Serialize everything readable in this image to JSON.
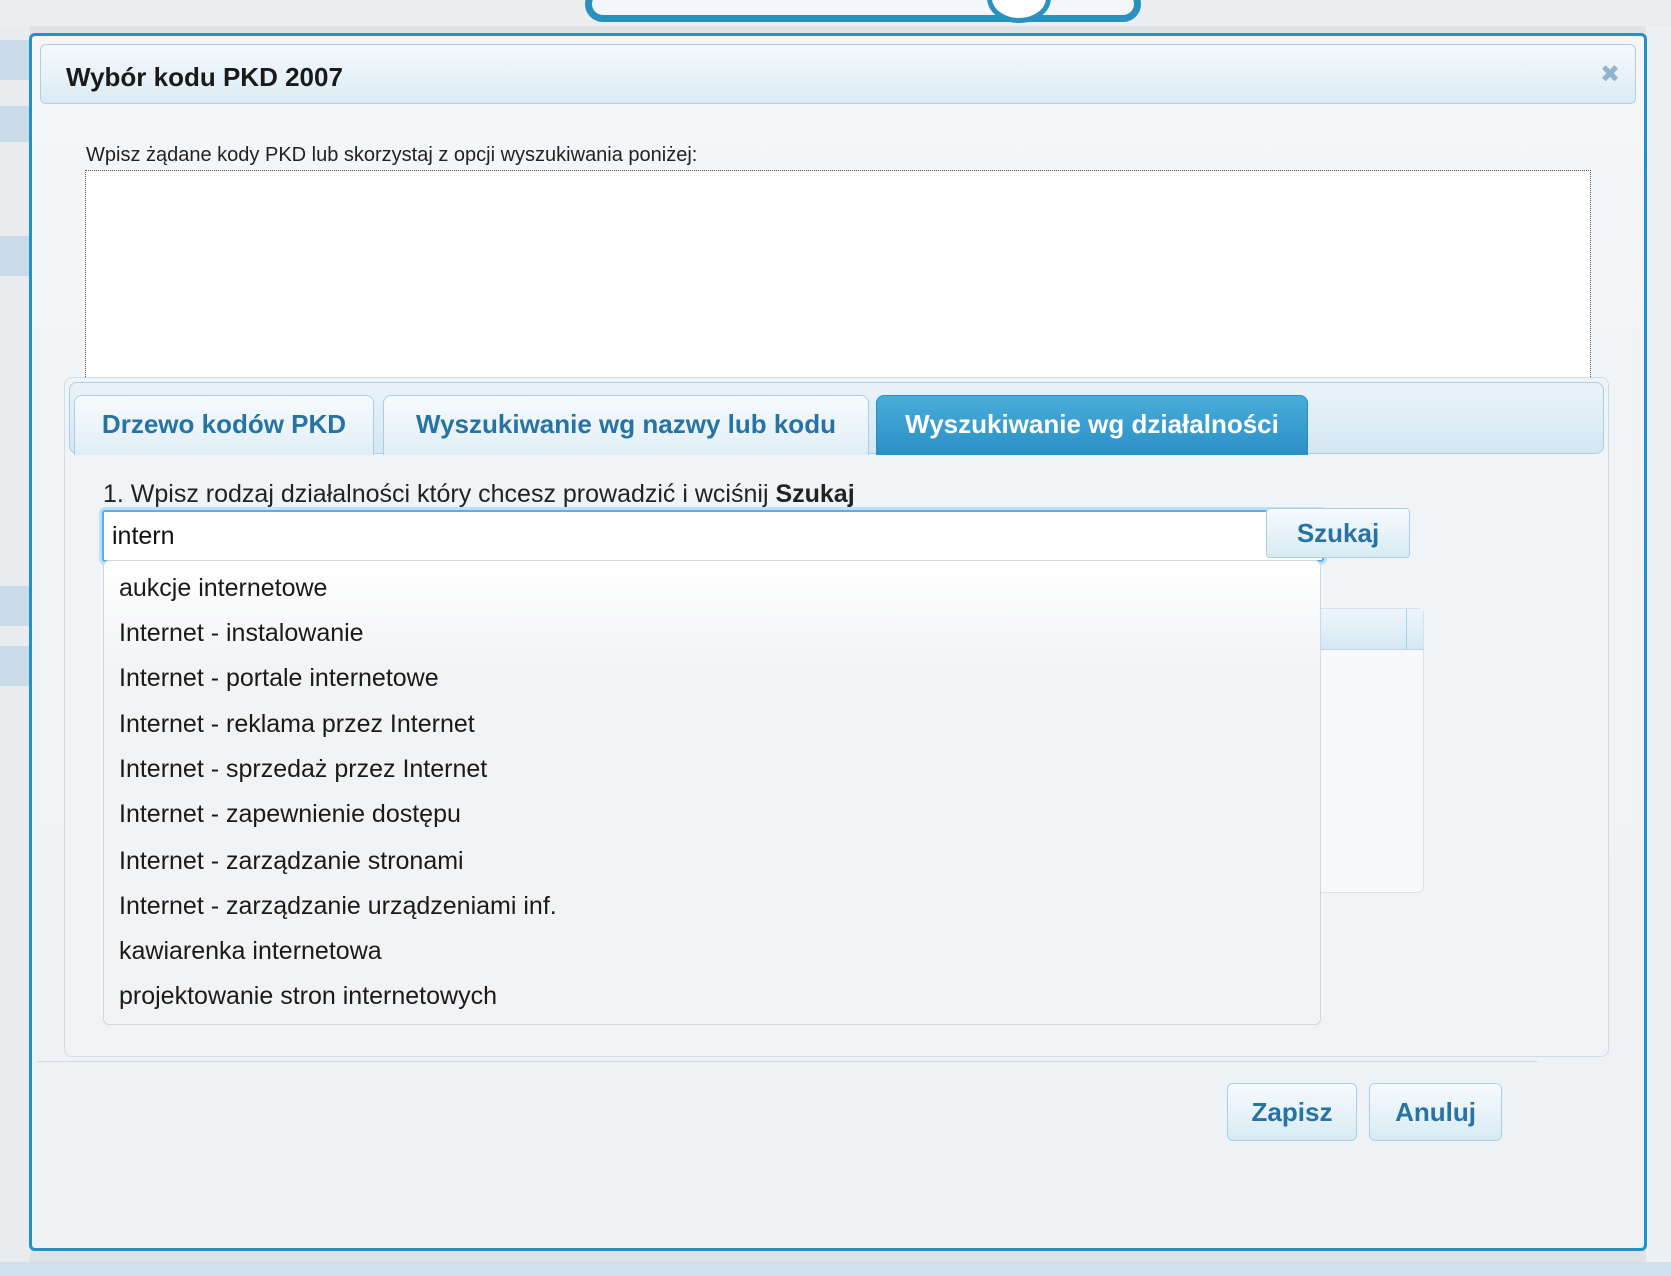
{
  "dialog": {
    "title": "Wybór kodu PKD 2007",
    "close_symbol": "✖",
    "instructions": "Wpisz żądane kody PKD lub skorzystaj z opcji wyszukiwania poniżej:",
    "codes_value": ""
  },
  "tabs": [
    {
      "label": "Drzewo kodów PKD",
      "active": false
    },
    {
      "label": "Wyszukiwanie wg nazwy lub kodu",
      "active": false
    },
    {
      "label": "Wyszukiwanie wg działalności",
      "active": true
    }
  ],
  "search": {
    "step_label": "1. Wpisz rodzaj działalności który chcesz prowadzić i wciśnij ",
    "step_label_bold": "Szukaj",
    "value": "intern",
    "button_label": "Szukaj"
  },
  "autocomplete": [
    "aukcje internetowe",
    "Internet - instalowanie",
    "Internet - portale internetowe",
    "Internet - reklama przez Internet",
    "Internet - sprzedaż przez Internet",
    "Internet - zapewnienie dostępu",
    "Internet - zarządzanie stronami",
    "Internet - zarządzanie urządzeniami inf.",
    "kawiarenka internetowa",
    "projektowanie stron internetowych"
  ],
  "footer": {
    "save_label": "Zapisz",
    "cancel_label": "Anuluj"
  },
  "colors": {
    "accent": "#2292c4",
    "tab_active": "#2a8fc4",
    "button_text": "#2673a4"
  }
}
